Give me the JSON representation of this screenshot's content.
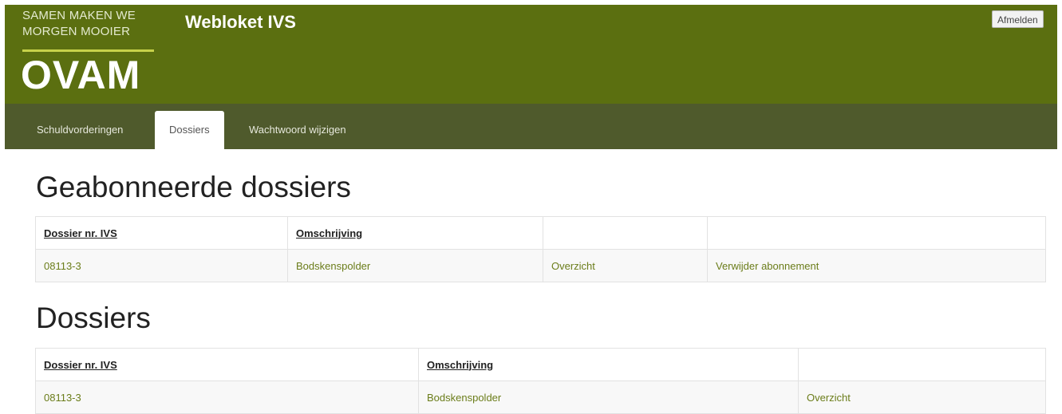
{
  "header": {
    "slogan_line1": "SAMEN MAKEN WE",
    "slogan_line2": "MORGEN MOOIER",
    "logo_text": "OVAM",
    "app_title": "Webloket IVS",
    "logout_label": "Afmelden",
    "brand_color": "#5b6f10"
  },
  "nav": {
    "tabs": [
      {
        "label": "Schuldvorderingen",
        "active": false
      },
      {
        "label": "Dossiers",
        "active": true
      },
      {
        "label": "Wachtwoord wijzigen",
        "active": false
      }
    ]
  },
  "subscribed": {
    "heading": "Geabonneerde dossiers",
    "columns": [
      "Dossier nr. IVS",
      "Omschrijving",
      "",
      ""
    ],
    "rows": [
      {
        "dossier_nr": "08113-3",
        "description": "Bodskenspolder",
        "overview": "Overzicht",
        "remove": "Verwijder abonnement"
      }
    ]
  },
  "dossiers": {
    "heading": "Dossiers",
    "columns": [
      "Dossier nr. IVS",
      "Omschrijving",
      ""
    ],
    "rows": [
      {
        "dossier_nr": "08113-3",
        "description": "Bodskenspolder",
        "overview": "Overzicht"
      }
    ]
  },
  "link_color": "#6b7d1a"
}
